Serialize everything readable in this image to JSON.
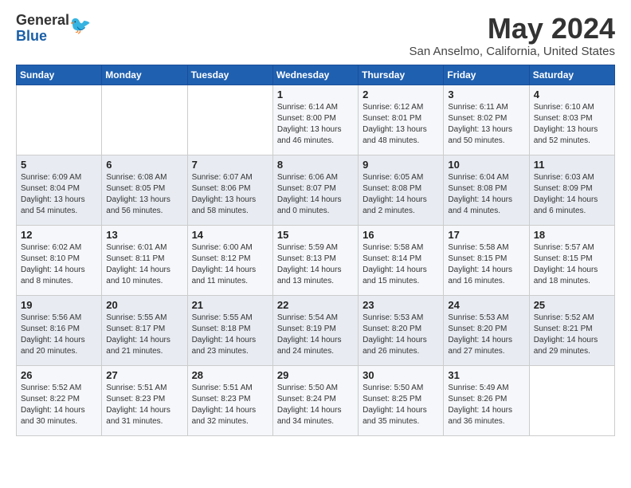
{
  "header": {
    "logo_general": "General",
    "logo_blue": "Blue",
    "month_year": "May 2024",
    "location": "San Anselmo, California, United States"
  },
  "weekdays": [
    "Sunday",
    "Monday",
    "Tuesday",
    "Wednesday",
    "Thursday",
    "Friday",
    "Saturday"
  ],
  "weeks": [
    [
      {
        "day": "",
        "info": ""
      },
      {
        "day": "",
        "info": ""
      },
      {
        "day": "",
        "info": ""
      },
      {
        "day": "1",
        "info": "Sunrise: 6:14 AM\nSunset: 8:00 PM\nDaylight: 13 hours\nand 46 minutes."
      },
      {
        "day": "2",
        "info": "Sunrise: 6:12 AM\nSunset: 8:01 PM\nDaylight: 13 hours\nand 48 minutes."
      },
      {
        "day": "3",
        "info": "Sunrise: 6:11 AM\nSunset: 8:02 PM\nDaylight: 13 hours\nand 50 minutes."
      },
      {
        "day": "4",
        "info": "Sunrise: 6:10 AM\nSunset: 8:03 PM\nDaylight: 13 hours\nand 52 minutes."
      }
    ],
    [
      {
        "day": "5",
        "info": "Sunrise: 6:09 AM\nSunset: 8:04 PM\nDaylight: 13 hours\nand 54 minutes."
      },
      {
        "day": "6",
        "info": "Sunrise: 6:08 AM\nSunset: 8:05 PM\nDaylight: 13 hours\nand 56 minutes."
      },
      {
        "day": "7",
        "info": "Sunrise: 6:07 AM\nSunset: 8:06 PM\nDaylight: 13 hours\nand 58 minutes."
      },
      {
        "day": "8",
        "info": "Sunrise: 6:06 AM\nSunset: 8:07 PM\nDaylight: 14 hours\nand 0 minutes."
      },
      {
        "day": "9",
        "info": "Sunrise: 6:05 AM\nSunset: 8:08 PM\nDaylight: 14 hours\nand 2 minutes."
      },
      {
        "day": "10",
        "info": "Sunrise: 6:04 AM\nSunset: 8:08 PM\nDaylight: 14 hours\nand 4 minutes."
      },
      {
        "day": "11",
        "info": "Sunrise: 6:03 AM\nSunset: 8:09 PM\nDaylight: 14 hours\nand 6 minutes."
      }
    ],
    [
      {
        "day": "12",
        "info": "Sunrise: 6:02 AM\nSunset: 8:10 PM\nDaylight: 14 hours\nand 8 minutes."
      },
      {
        "day": "13",
        "info": "Sunrise: 6:01 AM\nSunset: 8:11 PM\nDaylight: 14 hours\nand 10 minutes."
      },
      {
        "day": "14",
        "info": "Sunrise: 6:00 AM\nSunset: 8:12 PM\nDaylight: 14 hours\nand 11 minutes."
      },
      {
        "day": "15",
        "info": "Sunrise: 5:59 AM\nSunset: 8:13 PM\nDaylight: 14 hours\nand 13 minutes."
      },
      {
        "day": "16",
        "info": "Sunrise: 5:58 AM\nSunset: 8:14 PM\nDaylight: 14 hours\nand 15 minutes."
      },
      {
        "day": "17",
        "info": "Sunrise: 5:58 AM\nSunset: 8:15 PM\nDaylight: 14 hours\nand 16 minutes."
      },
      {
        "day": "18",
        "info": "Sunrise: 5:57 AM\nSunset: 8:15 PM\nDaylight: 14 hours\nand 18 minutes."
      }
    ],
    [
      {
        "day": "19",
        "info": "Sunrise: 5:56 AM\nSunset: 8:16 PM\nDaylight: 14 hours\nand 20 minutes."
      },
      {
        "day": "20",
        "info": "Sunrise: 5:55 AM\nSunset: 8:17 PM\nDaylight: 14 hours\nand 21 minutes."
      },
      {
        "day": "21",
        "info": "Sunrise: 5:55 AM\nSunset: 8:18 PM\nDaylight: 14 hours\nand 23 minutes."
      },
      {
        "day": "22",
        "info": "Sunrise: 5:54 AM\nSunset: 8:19 PM\nDaylight: 14 hours\nand 24 minutes."
      },
      {
        "day": "23",
        "info": "Sunrise: 5:53 AM\nSunset: 8:20 PM\nDaylight: 14 hours\nand 26 minutes."
      },
      {
        "day": "24",
        "info": "Sunrise: 5:53 AM\nSunset: 8:20 PM\nDaylight: 14 hours\nand 27 minutes."
      },
      {
        "day": "25",
        "info": "Sunrise: 5:52 AM\nSunset: 8:21 PM\nDaylight: 14 hours\nand 29 minutes."
      }
    ],
    [
      {
        "day": "26",
        "info": "Sunrise: 5:52 AM\nSunset: 8:22 PM\nDaylight: 14 hours\nand 30 minutes."
      },
      {
        "day": "27",
        "info": "Sunrise: 5:51 AM\nSunset: 8:23 PM\nDaylight: 14 hours\nand 31 minutes."
      },
      {
        "day": "28",
        "info": "Sunrise: 5:51 AM\nSunset: 8:23 PM\nDaylight: 14 hours\nand 32 minutes."
      },
      {
        "day": "29",
        "info": "Sunrise: 5:50 AM\nSunset: 8:24 PM\nDaylight: 14 hours\nand 34 minutes."
      },
      {
        "day": "30",
        "info": "Sunrise: 5:50 AM\nSunset: 8:25 PM\nDaylight: 14 hours\nand 35 minutes."
      },
      {
        "day": "31",
        "info": "Sunrise: 5:49 AM\nSunset: 8:26 PM\nDaylight: 14 hours\nand 36 minutes."
      },
      {
        "day": "",
        "info": ""
      }
    ]
  ]
}
